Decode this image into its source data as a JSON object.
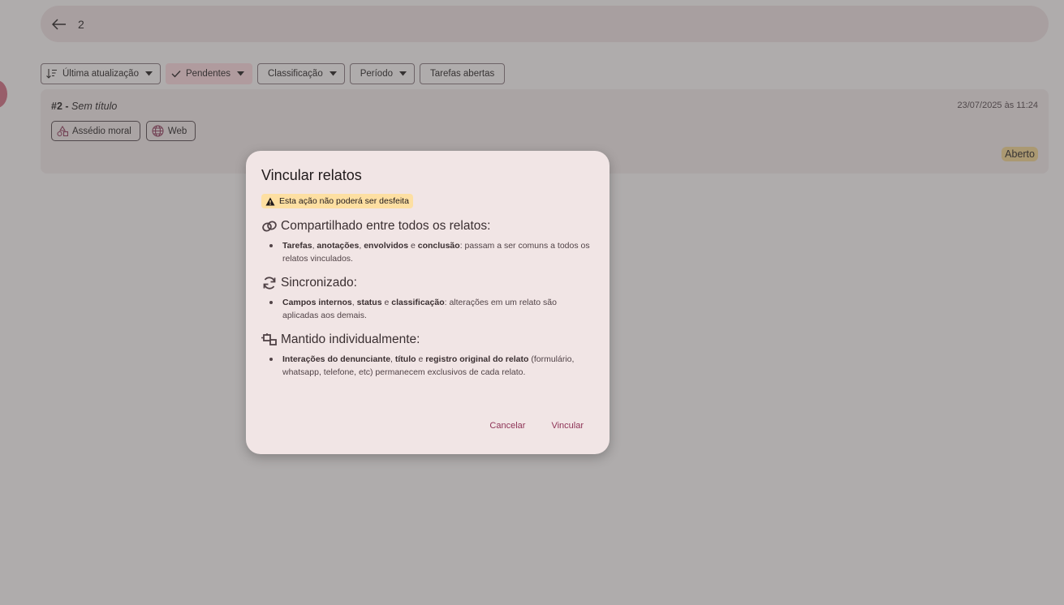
{
  "search": {
    "value": "2"
  },
  "filters": [
    {
      "label": "Última atualização",
      "icon": "sort-icon",
      "dropdown": true,
      "selected": false
    },
    {
      "label": "Pendentes",
      "icon": "check-icon",
      "dropdown": true,
      "selected": true
    },
    {
      "label": "Classificação",
      "dropdown": true,
      "selected": false
    },
    {
      "label": "Período",
      "dropdown": true,
      "selected": false
    },
    {
      "label": "Tarefas abertas",
      "dropdown": false,
      "selected": false
    }
  ],
  "report": {
    "number": "#2 -",
    "title": "Sem título",
    "date": "23/07/2025 às 11:24",
    "tags": [
      {
        "label": "Assédio moral",
        "icon": "category-icon"
      },
      {
        "label": "Web",
        "icon": "globe-icon"
      }
    ],
    "status": "Aberto"
  },
  "dialog": {
    "title": "Vincular relatos",
    "warning": "Esta ação não poderá ser desfeita",
    "sections": [
      {
        "icon": "link-icon",
        "heading": "Compartilhado entre todos os relatos:",
        "parts": [
          {
            "t": "Tarefas",
            "b": true
          },
          {
            "t": ", "
          },
          {
            "t": "anotações",
            "b": true
          },
          {
            "t": ", "
          },
          {
            "t": "envolvidos",
            "b": true
          },
          {
            "t": " e "
          },
          {
            "t": "conclusão",
            "b": true
          },
          {
            "t": ": passam a ser comuns a todos os relatos vinculados."
          }
        ]
      },
      {
        "icon": "sync-icon",
        "heading": "Sincronizado:",
        "parts": [
          {
            "t": "Campos internos",
            "b": true
          },
          {
            "t": ", "
          },
          {
            "t": "status",
            "b": true
          },
          {
            "t": " e "
          },
          {
            "t": "classificação",
            "b": true
          },
          {
            "t": ": alterações em um relato são aplicadas aos demais."
          }
        ]
      },
      {
        "icon": "split-icon",
        "heading": "Mantido individualmente:",
        "parts": [
          {
            "t": "Interações do denunciante",
            "b": true
          },
          {
            "t": ", "
          },
          {
            "t": "título",
            "b": true
          },
          {
            "t": " e "
          },
          {
            "t": "registro original do relato",
            "b": true
          },
          {
            "t": " (formulário, whatsapp, telefone, etc) permanecem exclusivos de cada relato."
          }
        ]
      }
    ],
    "cancel_label": "Cancelar",
    "confirm_label": "Vincular"
  },
  "colors": {
    "primary": "#8e3356",
    "warning_bg": "#fddfa2",
    "status_bg": "#f6d58f"
  }
}
